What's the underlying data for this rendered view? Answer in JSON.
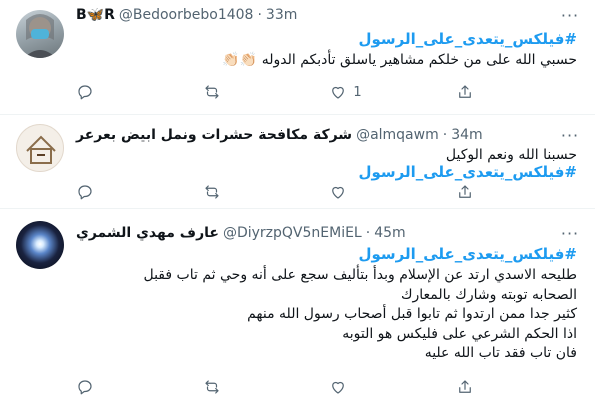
{
  "tweets": [
    {
      "name": "B🦋R",
      "handle": "@Bedoorbebo1408",
      "separator": "·",
      "time": "33m",
      "hashtag": "#فيلكس_يتعدى_على_الرسول",
      "lines": [
        "حسبي الله على من خلكم مشاهير ياسلق تأدبكم الدوله 👏🏻👏🏻"
      ],
      "likes": "1",
      "avatar_icon": "masked-woman-photo"
    },
    {
      "name": "شركة مكافحة حشرات ونمل ابيض بعرعر",
      "handle": "@almqawm",
      "separator": "·",
      "time": "34m",
      "lines": [
        "حسبنا الله ونعم الوكيل"
      ],
      "hashtag": "#فيلكس_يتعدى_على_الرسول",
      "avatar_icon": "pest-control-logo"
    },
    {
      "name": "عارف مهدي الشمري",
      "handle": "@DiyrzpQV5nEMiEL",
      "separator": "·",
      "time": "45m",
      "hashtag": "#فيلكس_يتعدى_على_الرسول",
      "lines": [
        "طليحه الاسدي ارتد عن الإسلام وبدأ بتأليف سجع على أنه وحي ثم تاب فقبل",
        "الصحابه توبته وشارك بالمعارك",
        "كثير جدا ممن ارتدوا ثم تابوا قبل أصحاب رسول الله منهم",
        "اذا الحكم الشرعي على فليكس هو التوبه",
        "فان تاب فقد تاب الله عليه"
      ],
      "avatar_icon": "light-burst-photo"
    }
  ],
  "icons": {
    "reply": "reply-icon",
    "retweet": "retweet-icon",
    "like": "like-icon",
    "share": "share-icon",
    "more": "more-icon"
  },
  "colors": {
    "hashtag": "#1d9bf0",
    "secondary_text": "#536471",
    "divider": "#eff3f4"
  }
}
